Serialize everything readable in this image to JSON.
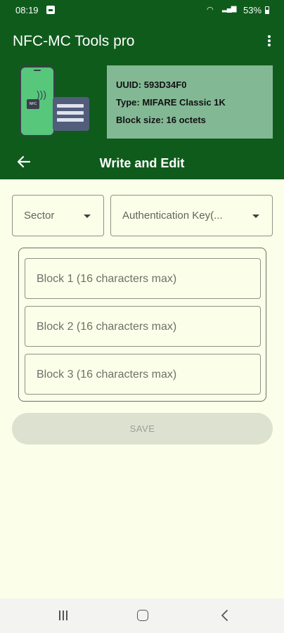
{
  "status_bar": {
    "time": "08:19",
    "battery": "53%",
    "icons": [
      "image-notification-icon",
      "wifi-icon",
      "signal-icon",
      "battery-icon"
    ]
  },
  "app": {
    "title": "NFC-MC Tools pro"
  },
  "tag_info": {
    "illustration_chip_label": "NFC",
    "uuid": "UUID: 593D34F0",
    "type": "Type: MIFARE Classic 1K",
    "block_size": "Block size: 16 octets"
  },
  "nav": {
    "title": "Write and Edit",
    "back_icon": "arrow-back-icon"
  },
  "form": {
    "sector_label": "Sector",
    "auth_key_label": "Authentication Key(...",
    "blocks": [
      {
        "placeholder": "Block 1 (16 characters max)"
      },
      {
        "placeholder": "Block 2 (16 characters max)"
      },
      {
        "placeholder": "Block 3 (16 characters max)"
      }
    ],
    "save_label": "SAVE"
  },
  "colors": {
    "primary": "#0f5b1c",
    "info_box": "#83b895",
    "background": "#fbfee9",
    "save_disabled": "#dde1d0"
  }
}
